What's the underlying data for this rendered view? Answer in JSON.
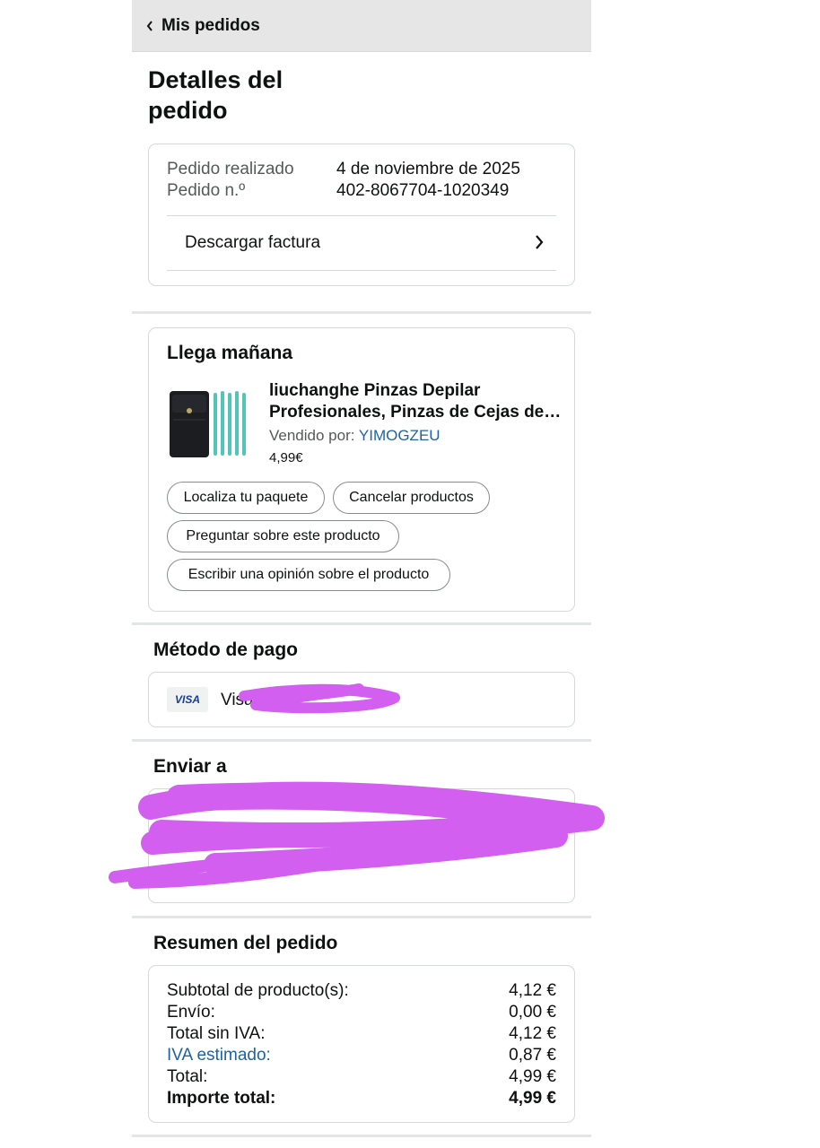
{
  "header": {
    "back_label": "Mis pedidos"
  },
  "page_title": "Detalles del pedido",
  "order_info": {
    "placed_label": "Pedido realizado",
    "placed_value": "4 de noviembre de 2025",
    "number_label": "Pedido n.º",
    "number_value": "402-8067704-1020349",
    "invoice_label": "Descargar factura"
  },
  "shipment": {
    "status": "Llega mañana",
    "product_title_line1": "liuchanghe Pinzas Depilar",
    "product_title_line2": "Profesionales, Pinzas de Cejas de…",
    "sold_by_label": "Vendido por:",
    "seller": "YIMOGZEU",
    "price": "4,99€",
    "buttons": {
      "track": "Localiza tu paquete",
      "cancel": "Cancelar productos",
      "ask": "Preguntar sobre este producto",
      "review": "Escribir una opinión sobre el producto"
    }
  },
  "payment": {
    "title": "Método de pago",
    "card_brand": "VISA",
    "card_text": "Visa"
  },
  "shipping": {
    "title": "Enviar a"
  },
  "summary": {
    "title": "Resumen del pedido",
    "rows": [
      {
        "label": "Subtotal de producto(s):",
        "value": "4,12 €"
      },
      {
        "label": "Envío:",
        "value": "0,00 €"
      },
      {
        "label": "Total sin IVA:",
        "value": "4,12 €"
      },
      {
        "label": "IVA estimado:",
        "value": "0,87 €"
      },
      {
        "label": "Total:",
        "value": "4,99 €"
      },
      {
        "label": "Importe total:",
        "value": "4,99 €"
      }
    ]
  },
  "colors": {
    "link": "#2162a1",
    "redaction": "#d35ff0",
    "topbar": "#e6e6e6"
  }
}
